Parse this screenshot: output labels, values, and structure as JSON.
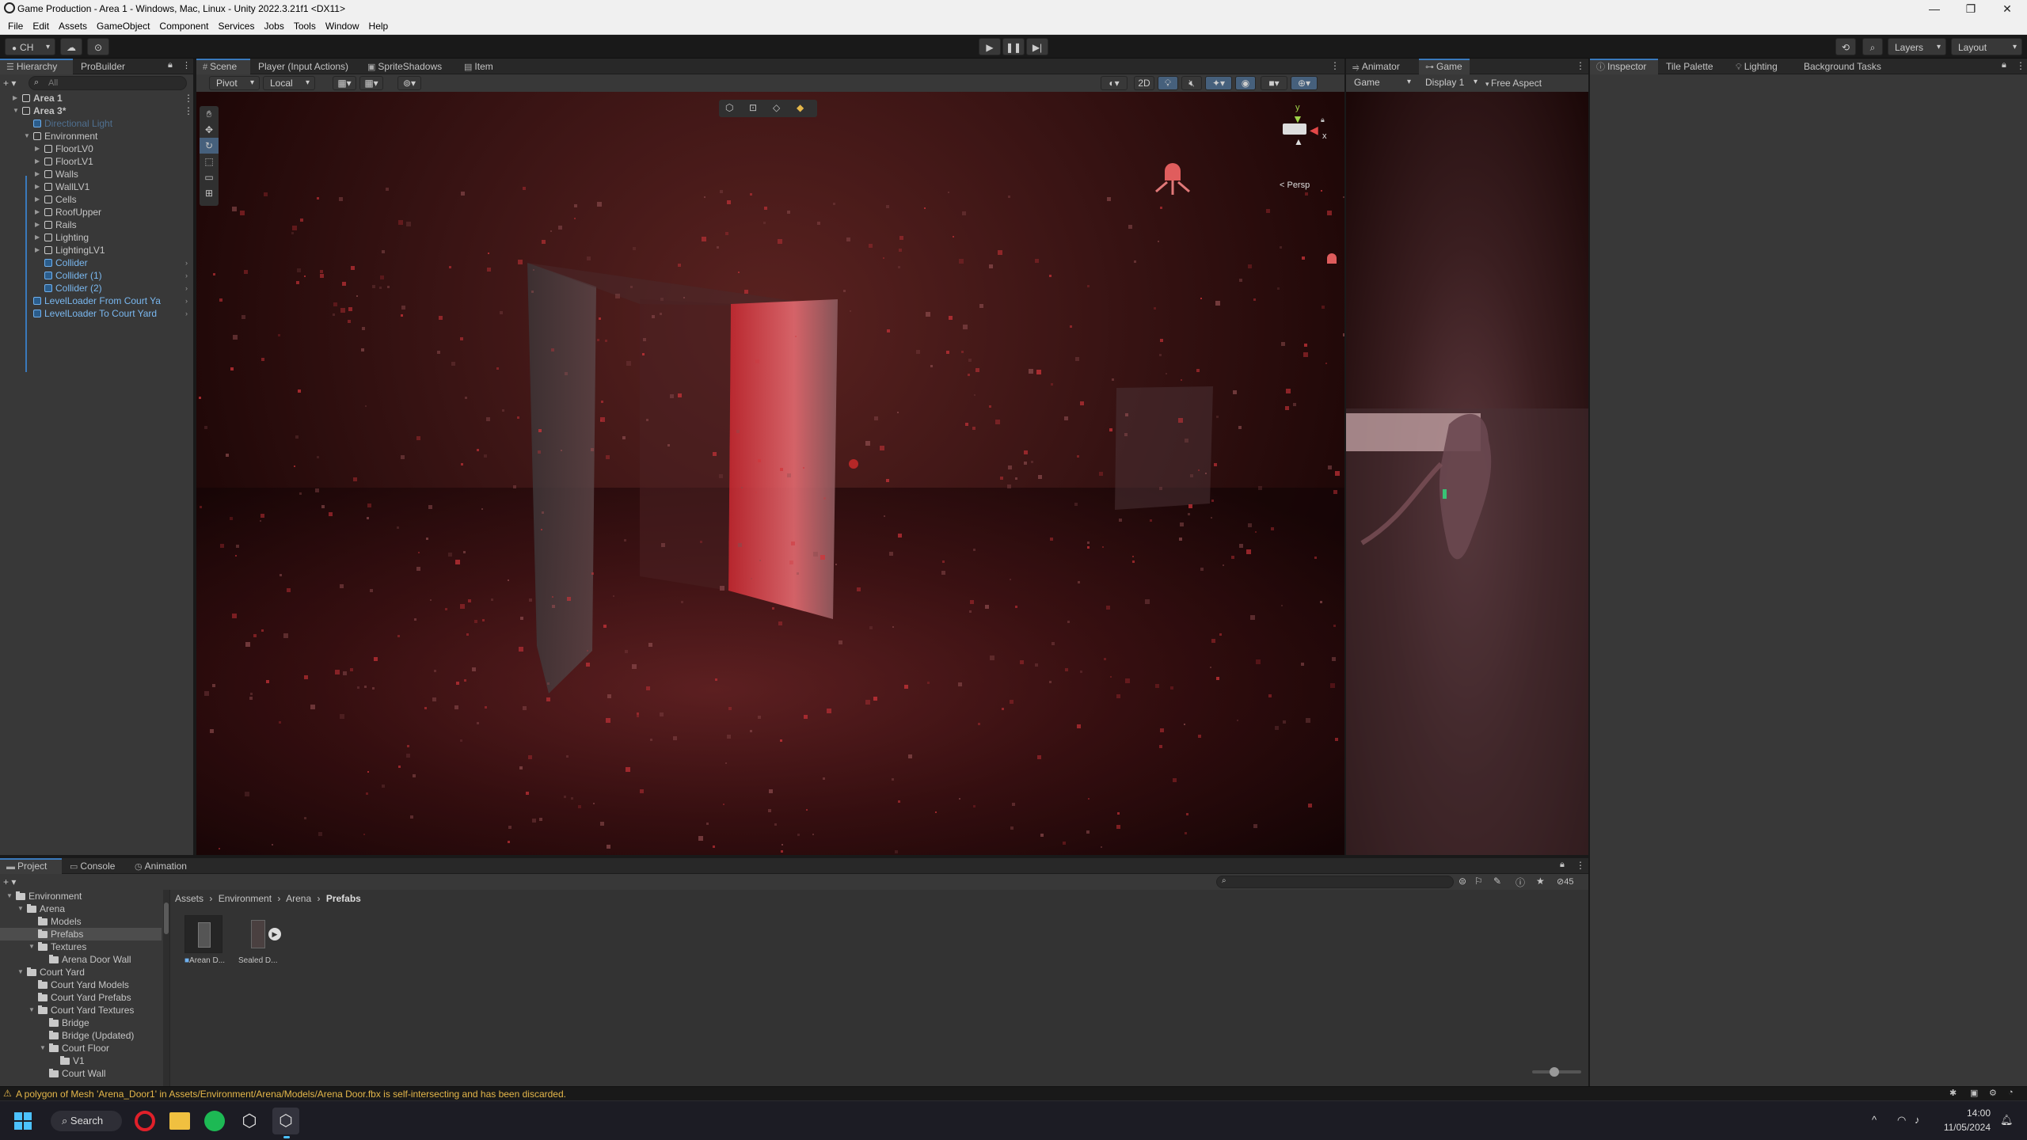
{
  "window": {
    "title": "Game Production - Area 1 - Windows, Mac, Linux - Unity 2022.3.21f1 <DX11>",
    "minimize": "—",
    "maximize": "❐",
    "close": "✕"
  },
  "menu": [
    "File",
    "Edit",
    "Assets",
    "GameObject",
    "Component",
    "Services",
    "Jobs",
    "Tools",
    "Window",
    "Help"
  ],
  "toolbar": {
    "account": "CH",
    "layers": "Layers",
    "layout": "Layout"
  },
  "hierarchy": {
    "tabs": [
      "Hierarchy",
      "ProBuilder"
    ],
    "search_placeholder": "All",
    "items": [
      {
        "label": "Area 1",
        "depth": 0,
        "expander": "▶",
        "kind": "scene",
        "bold": true
      },
      {
        "label": "Area 3*",
        "depth": 0,
        "expander": "▼",
        "kind": "scene",
        "bold": true
      },
      {
        "label": "Directional Light",
        "depth": 1,
        "expander": "",
        "kind": "dim"
      },
      {
        "label": "Environment",
        "depth": 1,
        "expander": "▼",
        "kind": "obj"
      },
      {
        "label": "FloorLV0",
        "depth": 2,
        "expander": "▶",
        "kind": "obj"
      },
      {
        "label": "FloorLV1",
        "depth": 2,
        "expander": "▶",
        "kind": "obj"
      },
      {
        "label": "Walls",
        "depth": 2,
        "expander": "▶",
        "kind": "obj"
      },
      {
        "label": "WallLV1",
        "depth": 2,
        "expander": "▶",
        "kind": "obj"
      },
      {
        "label": "Cells",
        "depth": 2,
        "expander": "▶",
        "kind": "obj"
      },
      {
        "label": "RoofUpper",
        "depth": 2,
        "expander": "▶",
        "kind": "obj"
      },
      {
        "label": "Rails",
        "depth": 2,
        "expander": "▶",
        "kind": "obj"
      },
      {
        "label": "Lighting",
        "depth": 2,
        "expander": "▶",
        "kind": "obj"
      },
      {
        "label": "LightingLV1",
        "depth": 2,
        "expander": "▶",
        "kind": "obj"
      },
      {
        "label": "Collider",
        "depth": 2,
        "expander": "",
        "kind": "prefab"
      },
      {
        "label": "Collider (1)",
        "depth": 2,
        "expander": "",
        "kind": "prefab"
      },
      {
        "label": "Collider (2)",
        "depth": 2,
        "expander": "",
        "kind": "prefab"
      },
      {
        "label": "LevelLoader From Court Ya",
        "depth": 1,
        "expander": "",
        "kind": "prefab"
      },
      {
        "label": "LevelLoader To Court Yard",
        "depth": 1,
        "expander": "",
        "kind": "prefab"
      }
    ]
  },
  "scene": {
    "tabs": [
      "Scene",
      "Player (Input Actions)",
      "SpriteShadows",
      "Item"
    ],
    "pivot": "Pivot",
    "local": "Local",
    "mode_2d": "2D",
    "persp": "< Persp",
    "axis_y": "y",
    "axis_x": "x"
  },
  "game": {
    "tabs": [
      "Animator",
      "Game"
    ],
    "mode": "Game",
    "display": "Display 1",
    "aspect": "Free Aspect"
  },
  "inspector": {
    "tabs": [
      "Inspector",
      "Tile Palette",
      "Lighting",
      "Background Tasks"
    ]
  },
  "project": {
    "tabs": [
      "Project",
      "Console",
      "Animation"
    ],
    "tree": [
      {
        "label": "Environment",
        "depth": 0,
        "expander": "▼"
      },
      {
        "label": "Arena",
        "depth": 1,
        "expander": "▼"
      },
      {
        "label": "Models",
        "depth": 2,
        "expander": ""
      },
      {
        "label": "Prefabs",
        "depth": 2,
        "expander": "",
        "selected": true
      },
      {
        "label": "Textures",
        "depth": 2,
        "expander": "▼"
      },
      {
        "label": "Arena Door Wall",
        "depth": 3,
        "expander": ""
      },
      {
        "label": "Court Yard",
        "depth": 1,
        "expander": "▼"
      },
      {
        "label": "Court Yard Models",
        "depth": 2,
        "expander": ""
      },
      {
        "label": "Court Yard Prefabs",
        "depth": 2,
        "expander": ""
      },
      {
        "label": "Court Yard Textures",
        "depth": 2,
        "expander": "▼"
      },
      {
        "label": "Bridge",
        "depth": 3,
        "expander": ""
      },
      {
        "label": "Bridge (Updated)",
        "depth": 3,
        "expander": ""
      },
      {
        "label": "Court Floor",
        "depth": 3,
        "expander": "▼"
      },
      {
        "label": "V1",
        "depth": 4,
        "expander": ""
      },
      {
        "label": "Court Wall",
        "depth": 3,
        "expander": ""
      }
    ],
    "breadcrumb": [
      "Assets",
      "Environment",
      "Arena",
      "Prefabs"
    ],
    "hidden_count": "45",
    "assets": [
      {
        "label": "Arean D..."
      },
      {
        "label": "Sealed D..."
      }
    ]
  },
  "status": {
    "message": "A polygon of Mesh 'Arena_Door1' in Assets/Environment/Arena/Models/Arena Door.fbx is self-intersecting and has been discarded."
  },
  "taskbar": {
    "search": "Search",
    "time": "14:00",
    "date": "11/05/2024"
  },
  "colors": {
    "accent": "#3a79bb",
    "warning": "#e5b74a",
    "panel": "#383838"
  }
}
